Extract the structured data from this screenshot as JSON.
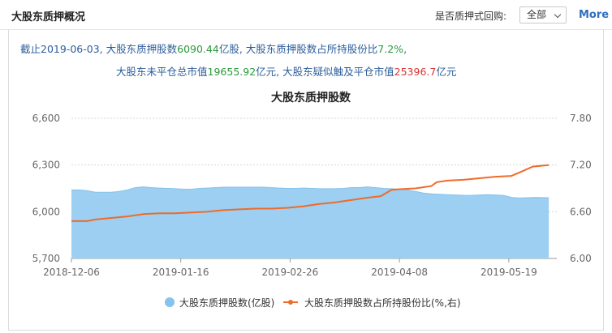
{
  "header": {
    "title": "大股东质押概况",
    "filter_label": "是否质押式回购:",
    "filter_value": "全部",
    "more_label": "More"
  },
  "summary": {
    "prefix": "截止",
    "date": "2019-06-03",
    "sep1": ", 大股东质押股数",
    "pledged_shares": "6090.44",
    "unit1": "亿股",
    "sep2": ", 大股东质押股数占所持股份比",
    "ratio": "7.2%",
    "end1": ",",
    "line2_prefix": "大股东未平仓总市值",
    "open_value": "19655.92",
    "unit2": "亿元",
    "sep3": ", 大股东疑似触及平仓市值",
    "trigger_value": "25396.7",
    "unit3": "亿元"
  },
  "colors": {
    "area": "#9ccff1",
    "area_line": "#86c3ec",
    "line": "#ef6b2a",
    "green": "#2a9a3a",
    "red": "#d93434"
  },
  "chart_data": {
    "type": "area",
    "title": "大股东质押股数",
    "x_ticks": [
      "2018-12-06",
      "2019-01-16",
      "2019-02-26",
      "2019-04-08",
      "2019-05-19"
    ],
    "ylim_left": [
      5700,
      6600
    ],
    "yticks_left": [
      "6,600",
      "6,300",
      "6,000",
      "5,700"
    ],
    "ylim_right": [
      6.0,
      7.8
    ],
    "yticks_right": [
      "7.80",
      "7.20",
      "6.60",
      "6.00"
    ],
    "legend_position": "bottom",
    "series": [
      {
        "name": "大股东质押股数(亿股)",
        "type": "area",
        "axis": "left",
        "points": [
          [
            "2018-12-06",
            6140
          ],
          [
            "2018-12-09",
            6140
          ],
          [
            "2018-12-12",
            6135
          ],
          [
            "2018-12-15",
            6125
          ],
          [
            "2018-12-18",
            6125
          ],
          [
            "2018-12-21",
            6125
          ],
          [
            "2018-12-24",
            6130
          ],
          [
            "2018-12-27",
            6140
          ],
          [
            "2018-12-30",
            6155
          ],
          [
            "2019-01-02",
            6160
          ],
          [
            "2019-01-05",
            6155
          ],
          [
            "2019-01-08",
            6152
          ],
          [
            "2019-01-11",
            6150
          ],
          [
            "2019-01-14",
            6148
          ],
          [
            "2019-01-17",
            6145
          ],
          [
            "2019-01-20",
            6145
          ],
          [
            "2019-01-23",
            6150
          ],
          [
            "2019-01-26",
            6152
          ],
          [
            "2019-01-29",
            6155
          ],
          [
            "2019-02-01",
            6158
          ],
          [
            "2019-02-04",
            6158
          ],
          [
            "2019-02-07",
            6158
          ],
          [
            "2019-02-10",
            6158
          ],
          [
            "2019-02-13",
            6158
          ],
          [
            "2019-02-16",
            6158
          ],
          [
            "2019-02-19",
            6155
          ],
          [
            "2019-02-22",
            6152
          ],
          [
            "2019-02-25",
            6150
          ],
          [
            "2019-02-28",
            6150
          ],
          [
            "2019-03-03",
            6152
          ],
          [
            "2019-03-06",
            6150
          ],
          [
            "2019-03-09",
            6148
          ],
          [
            "2019-03-12",
            6148
          ],
          [
            "2019-03-15",
            6148
          ],
          [
            "2019-03-18",
            6150
          ],
          [
            "2019-03-21",
            6155
          ],
          [
            "2019-03-24",
            6155
          ],
          [
            "2019-03-27",
            6160
          ],
          [
            "2019-03-30",
            6155
          ],
          [
            "2019-04-02",
            6150
          ],
          [
            "2019-04-05",
            6148
          ],
          [
            "2019-04-08",
            6145
          ],
          [
            "2019-04-11",
            6140
          ],
          [
            "2019-04-14",
            6130
          ],
          [
            "2019-04-17",
            6120
          ],
          [
            "2019-04-20",
            6115
          ],
          [
            "2019-04-23",
            6112
          ],
          [
            "2019-04-26",
            6110
          ],
          [
            "2019-04-29",
            6108
          ],
          [
            "2019-05-02",
            6106
          ],
          [
            "2019-05-05",
            6105
          ],
          [
            "2019-05-08",
            6108
          ],
          [
            "2019-05-11",
            6110
          ],
          [
            "2019-05-14",
            6108
          ],
          [
            "2019-05-17",
            6105
          ],
          [
            "2019-05-20",
            6092
          ],
          [
            "2019-05-23",
            6088
          ],
          [
            "2019-05-26",
            6090
          ],
          [
            "2019-05-29",
            6092
          ],
          [
            "2019-06-03",
            6090
          ]
        ]
      },
      {
        "name": "大股东质押股数占所持股份比(%,右)",
        "type": "line",
        "axis": "right",
        "points": [
          [
            "2018-12-06",
            6.48
          ],
          [
            "2018-12-12",
            6.48
          ],
          [
            "2018-12-15",
            6.5
          ],
          [
            "2018-12-21",
            6.52
          ],
          [
            "2018-12-27",
            6.54
          ],
          [
            "2019-01-02",
            6.57
          ],
          [
            "2019-01-08",
            6.58
          ],
          [
            "2019-01-14",
            6.58
          ],
          [
            "2019-01-20",
            6.59
          ],
          [
            "2019-01-26",
            6.6
          ],
          [
            "2019-02-01",
            6.62
          ],
          [
            "2019-02-07",
            6.63
          ],
          [
            "2019-02-13",
            6.64
          ],
          [
            "2019-02-19",
            6.64
          ],
          [
            "2019-02-25",
            6.65
          ],
          [
            "2019-03-03",
            6.67
          ],
          [
            "2019-03-09",
            6.7
          ],
          [
            "2019-03-15",
            6.72
          ],
          [
            "2019-03-21",
            6.75
          ],
          [
            "2019-03-27",
            6.78
          ],
          [
            "2019-04-01",
            6.8
          ],
          [
            "2019-04-05",
            6.88
          ],
          [
            "2019-04-08",
            6.89
          ],
          [
            "2019-04-14",
            6.9
          ],
          [
            "2019-04-20",
            6.93
          ],
          [
            "2019-04-22",
            6.98
          ],
          [
            "2019-04-26",
            7.0
          ],
          [
            "2019-05-02",
            7.01
          ],
          [
            "2019-05-08",
            7.03
          ],
          [
            "2019-05-14",
            7.05
          ],
          [
            "2019-05-20",
            7.06
          ],
          [
            "2019-05-24",
            7.12
          ],
          [
            "2019-05-28",
            7.18
          ],
          [
            "2019-06-03",
            7.2
          ]
        ]
      }
    ]
  }
}
